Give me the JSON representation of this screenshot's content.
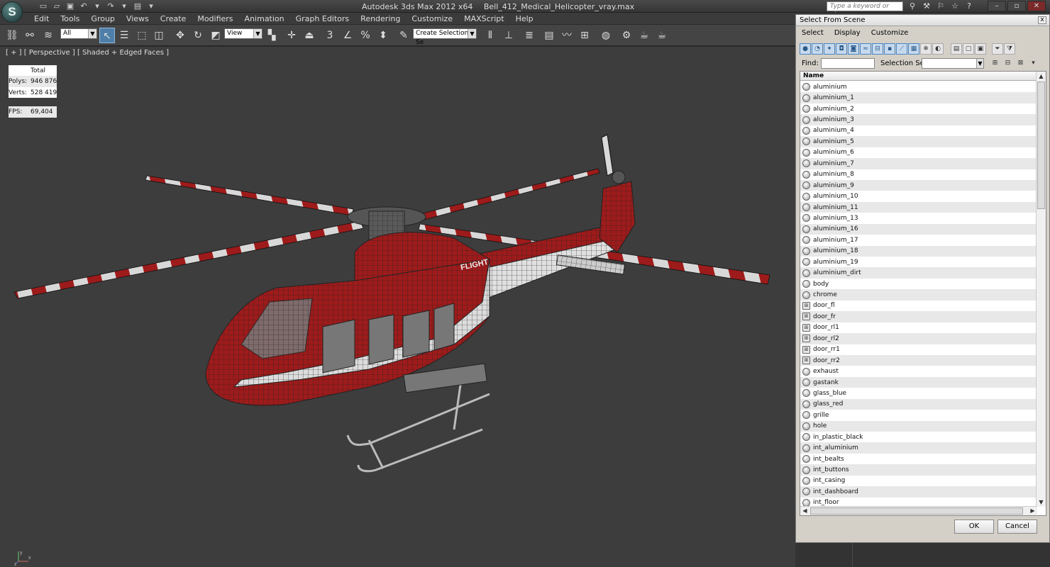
{
  "app": {
    "logo_text": "S",
    "name": "Autodesk 3ds Max  2012 x64",
    "file": "Bell_412_Medical_Helicopter_vray.max",
    "search_placeholder": "Type a keyword or phrase"
  },
  "menu": [
    "Edit",
    "Tools",
    "Group",
    "Views",
    "Create",
    "Modifiers",
    "Animation",
    "Graph Editors",
    "Rendering",
    "Customize",
    "MAXScript",
    "Help"
  ],
  "toolbar": {
    "filter": "All",
    "ref_coord": "View",
    "snap_num": "3",
    "named_selection": "Create Selection Se"
  },
  "viewport": {
    "label": "[ + ] [ Perspective ] [ Shaded + Edged Faces ]",
    "stats": {
      "header": "Total",
      "polys_label": "Polys:",
      "polys": "946 876",
      "verts_label": "Verts:",
      "verts": "528 419",
      "fps_label": "FPS:",
      "fps": "69,404"
    },
    "axis_y": "y",
    "axis_x": "x",
    "axis_z": "z",
    "livery": "FLIGHT"
  },
  "dialog": {
    "title": "Select From Scene",
    "close": "x",
    "menu": [
      "Select",
      "Display",
      "Customize"
    ],
    "find_label": "Find:",
    "selset_label": "Selection Set:",
    "column_name": "Name",
    "items": [
      {
        "name": "aluminium",
        "group": false
      },
      {
        "name": "aluminium_1",
        "group": false
      },
      {
        "name": "aluminium_2",
        "group": false
      },
      {
        "name": "aluminium_3",
        "group": false
      },
      {
        "name": "aluminium_4",
        "group": false
      },
      {
        "name": "aluminium_5",
        "group": false
      },
      {
        "name": "aluminium_6",
        "group": false
      },
      {
        "name": "aluminium_7",
        "group": false
      },
      {
        "name": "aluminium_8",
        "group": false
      },
      {
        "name": "aluminium_9",
        "group": false
      },
      {
        "name": "aluminium_10",
        "group": false
      },
      {
        "name": "aluminium_11",
        "group": false
      },
      {
        "name": "aluminium_13",
        "group": false
      },
      {
        "name": "aluminium_16",
        "group": false
      },
      {
        "name": "aluminium_17",
        "group": false
      },
      {
        "name": "aluminium_18",
        "group": false
      },
      {
        "name": "aluminium_19",
        "group": false
      },
      {
        "name": "aluminium_dirt",
        "group": false
      },
      {
        "name": "body",
        "group": false
      },
      {
        "name": "chrome",
        "group": false
      },
      {
        "name": "door_fl",
        "group": true
      },
      {
        "name": "door_fr",
        "group": true
      },
      {
        "name": "door_rl1",
        "group": true
      },
      {
        "name": "door_rl2",
        "group": true
      },
      {
        "name": "door_rr1",
        "group": true
      },
      {
        "name": "door_rr2",
        "group": true
      },
      {
        "name": "exhaust",
        "group": false
      },
      {
        "name": "gastank",
        "group": false
      },
      {
        "name": "glass_blue",
        "group": false
      },
      {
        "name": "glass_red",
        "group": false
      },
      {
        "name": "grille",
        "group": false
      },
      {
        "name": "hole",
        "group": false
      },
      {
        "name": "in_plastic_black",
        "group": false
      },
      {
        "name": "int_aluminium",
        "group": false
      },
      {
        "name": "int_bealts",
        "group": false
      },
      {
        "name": "int_buttons",
        "group": false
      },
      {
        "name": "int_casing",
        "group": false
      },
      {
        "name": "int_dashboard",
        "group": false
      },
      {
        "name": "int_floor",
        "group": false
      }
    ],
    "ok": "OK",
    "cancel": "Cancel"
  },
  "colors": {
    "livery_red": "#9e1b1b",
    "livery_white": "#e6e6e6",
    "viewport_bg": "#3d3d3d",
    "stats_yellow": "#e8e85a",
    "selection_blue": "#4f7fa8"
  }
}
